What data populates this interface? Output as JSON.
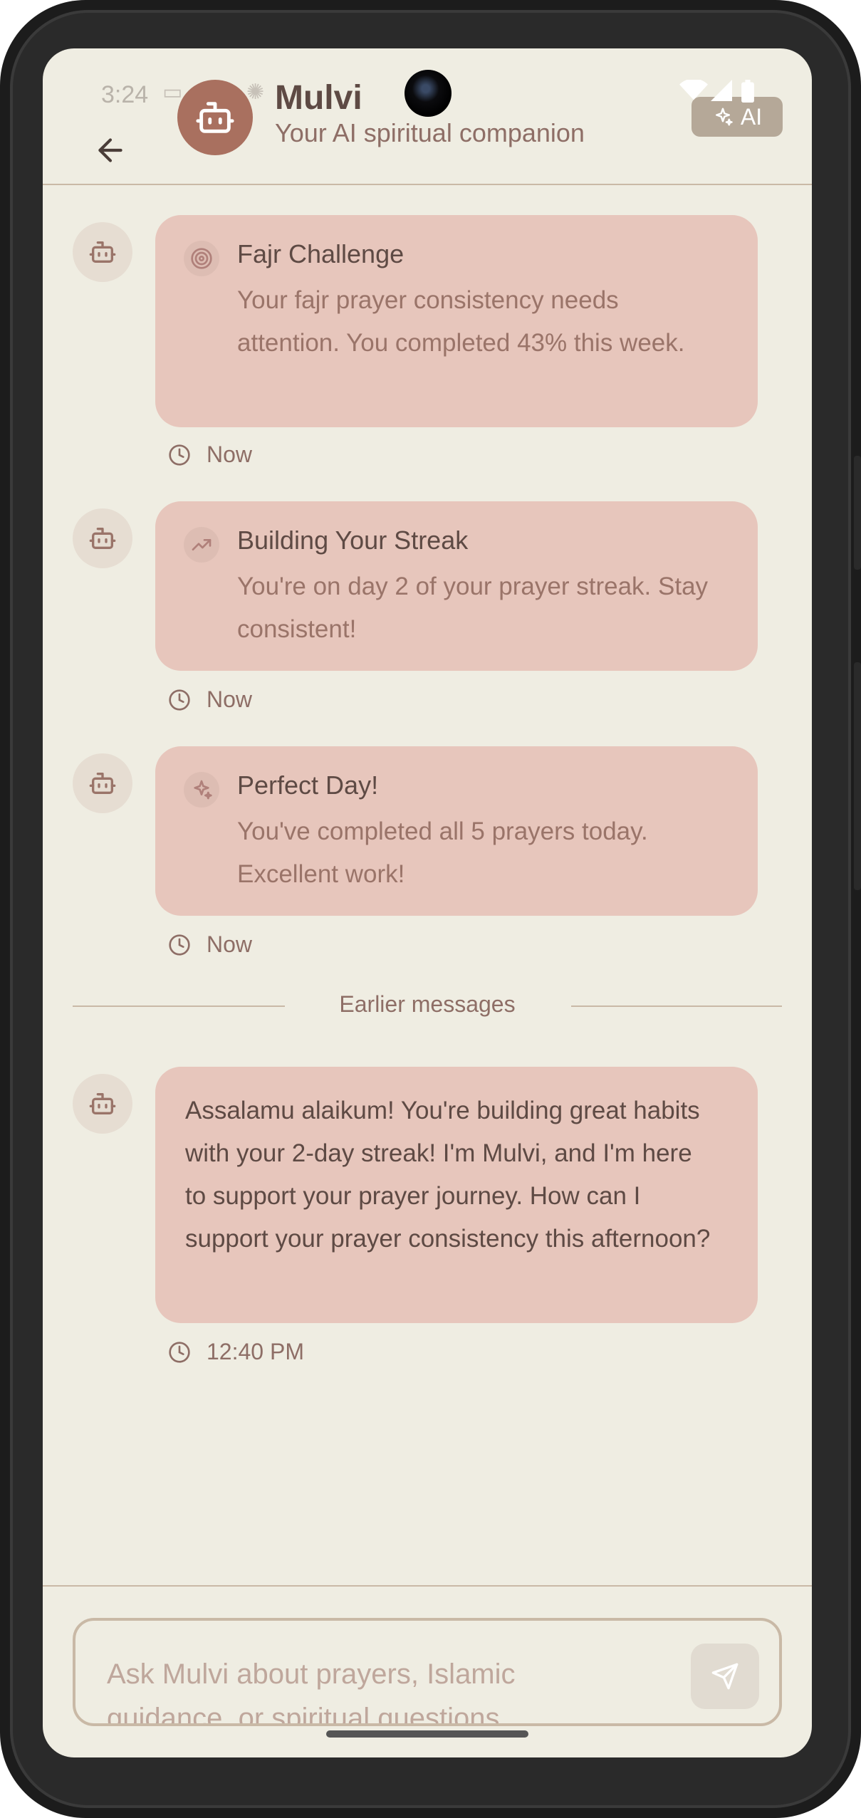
{
  "status_bar": {
    "time": "3:24"
  },
  "header": {
    "title": "Mulvi",
    "subtitle": "Your AI spiritual companion",
    "ai_badge": "AI"
  },
  "messages": [
    {
      "type": "card",
      "icon": "target-icon",
      "title": "Fajr Challenge",
      "body": "Your fajr prayer consistency needs attention. You completed 43% this week.",
      "time": "Now"
    },
    {
      "type": "card",
      "icon": "trending-up-icon",
      "title": "Building Your Streak",
      "body": "You're on day 2 of your prayer streak. Stay consistent!",
      "time": "Now"
    },
    {
      "type": "card",
      "icon": "sparkles-icon",
      "title": "Perfect Day!",
      "body": "You've completed all 5 prayers today. Excellent work!",
      "time": "Now"
    }
  ],
  "divider": {
    "label": "Earlier messages"
  },
  "earlier_message": {
    "body": "Assalamu alaikum! You're building great habits with your 2-day streak! I'm Mulvi, and I'm here to support your prayer journey. How can I support your prayer consistency this afternoon?",
    "time": "12:40 PM"
  },
  "input": {
    "placeholder": "Ask Mulvi about prayers, Islamic guidance, or spiritual questions..."
  },
  "colors": {
    "background": "#efede2",
    "bubble": "#e7c6bc",
    "accent": "#a9705f",
    "text_primary": "#5e4a44",
    "text_secondary": "#8e6e66"
  }
}
